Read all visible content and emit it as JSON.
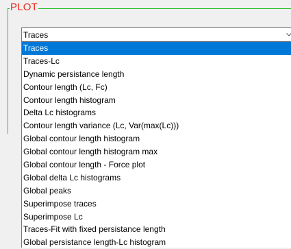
{
  "group": {
    "title": "PLOT"
  },
  "combo": {
    "value": "Traces",
    "arrow_icon": "chevron-down-icon"
  },
  "dropdown": {
    "selected_index": 0,
    "options": [
      "Traces",
      "Traces-Lc",
      "Dynamic persistance length",
      "Contour length (Lc, Fc)",
      "Contour length histogram",
      "Delta Lc histograms",
      "Contour length variance (Lc, Var(max(Lc)))",
      "Global contour length histogram",
      "Global contour length histogram max",
      "Global contour length - Force plot",
      "Global delta Lc histograms",
      "Global peaks",
      "Superimpose traces",
      "Superimpose Lc",
      "Traces-Fit with fixed persistance length",
      "Global persistance length-Lc histogram"
    ]
  },
  "colors": {
    "group_border": "#2fc02f",
    "group_title": "#e8261b",
    "selection": "#0078d7"
  }
}
